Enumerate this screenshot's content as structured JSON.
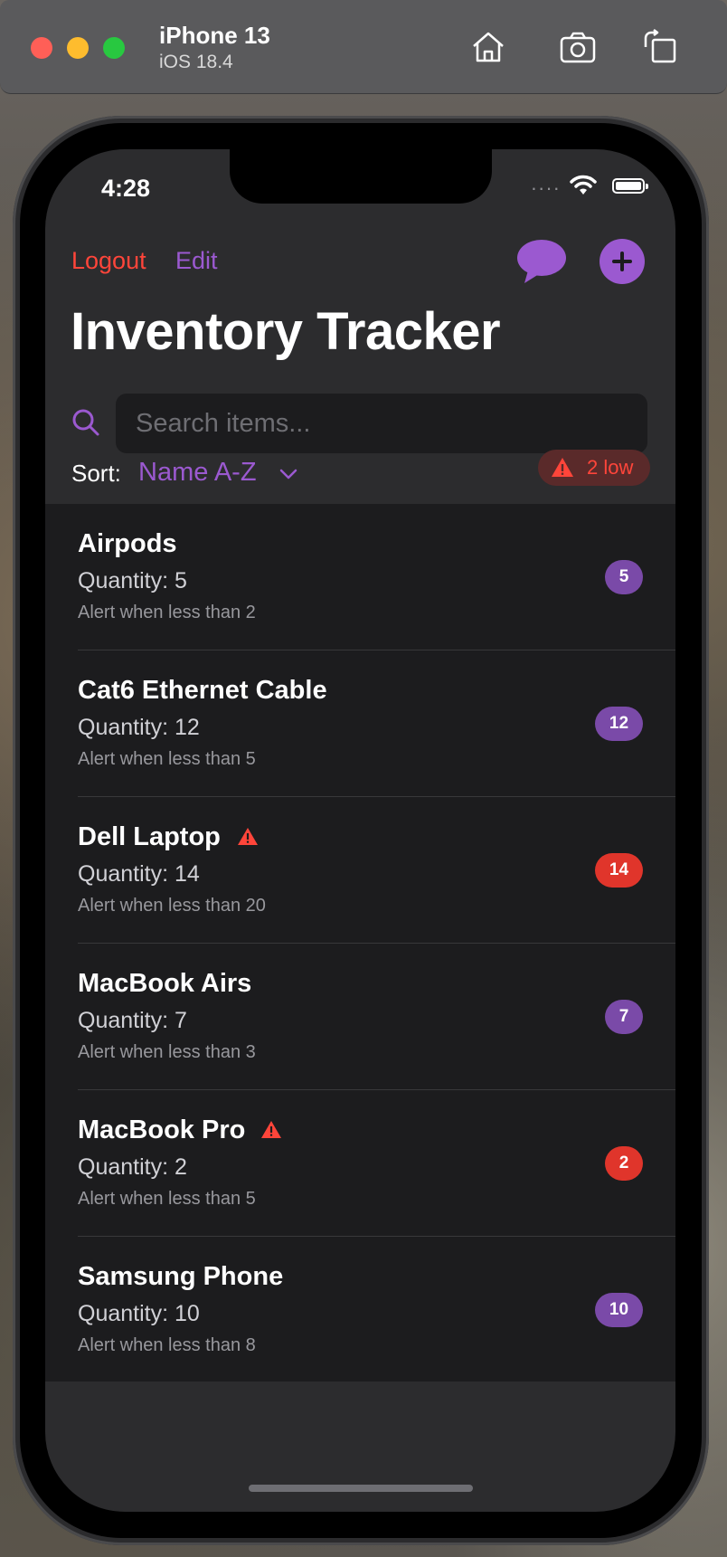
{
  "simulator": {
    "device_name": "iPhone 13",
    "os_version": "iOS 18.4",
    "icons": [
      "home-icon",
      "screenshot-icon",
      "rotate-icon"
    ]
  },
  "status_bar": {
    "time": "4:28",
    "signal": "····"
  },
  "nav": {
    "logout_label": "Logout",
    "edit_label": "Edit",
    "chat_icon": "chat-bubble-icon",
    "add_icon": "plus-icon"
  },
  "page": {
    "title": "Inventory Tracker"
  },
  "search": {
    "placeholder": "Search items..."
  },
  "sort": {
    "label": "Sort:",
    "value": "Name A-Z"
  },
  "low_stock_badge": {
    "text": "2 low"
  },
  "items": [
    {
      "name": "Airpods",
      "quantity_text": "Quantity: 5",
      "alert_text": "Alert when less than 2",
      "count": "5",
      "low": false
    },
    {
      "name": "Cat6 Ethernet Cable",
      "quantity_text": "Quantity: 12",
      "alert_text": "Alert when less than 5",
      "count": "12",
      "low": false
    },
    {
      "name": "Dell Laptop",
      "quantity_text": "Quantity: 14",
      "alert_text": "Alert when less than 20",
      "count": "14",
      "low": true
    },
    {
      "name": "MacBook Airs",
      "quantity_text": "Quantity: 7",
      "alert_text": "Alert when less than 3",
      "count": "7",
      "low": false
    },
    {
      "name": "MacBook Pro",
      "quantity_text": "Quantity: 2",
      "alert_text": "Alert when less than 5",
      "count": "2",
      "low": true
    },
    {
      "name": "Samsung Phone",
      "quantity_text": "Quantity: 10",
      "alert_text": "Alert when less than 8",
      "count": "10",
      "low": false
    }
  ],
  "colors": {
    "accent": "#9b59d0",
    "danger": "#ff453a",
    "background": "#2c2c2e",
    "list_background": "#1c1c1e"
  }
}
